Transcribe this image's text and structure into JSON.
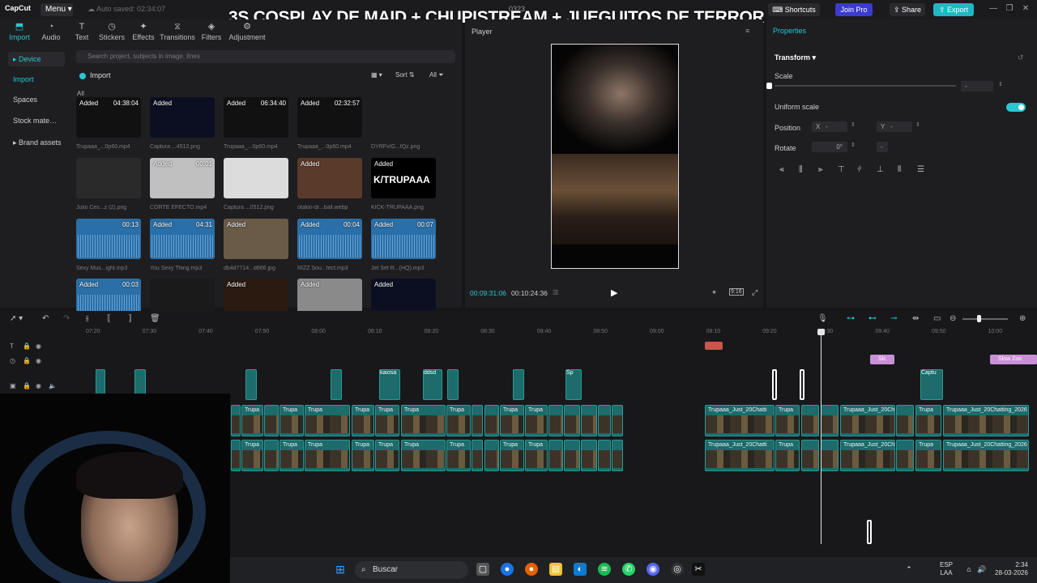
{
  "app": {
    "logo": "CapCut",
    "menu_label": "Menu",
    "autosave": "Auto saved: 02:34:07",
    "project_name": "0323"
  },
  "overlay_title": "3S COSPLAY DE MAID + CHUPISTREAM + JUEGUITOS DE TERROR",
  "topbar": {
    "shortcuts": "Shortcuts",
    "join_pro": "Join Pro",
    "share": "Share",
    "export": "Export"
  },
  "tool_tabs": [
    {
      "label": "Import",
      "icon": "import-icon"
    },
    {
      "label": "Audio",
      "icon": "audio-icon"
    },
    {
      "label": "Text",
      "icon": "text-icon"
    },
    {
      "label": "Stickers",
      "icon": "stickers-icon"
    },
    {
      "label": "Effects",
      "icon": "effects-icon"
    },
    {
      "label": "Transitions",
      "icon": "transitions-icon"
    },
    {
      "label": "Filters",
      "icon": "filters-icon"
    },
    {
      "label": "Adjustment",
      "icon": "adjustment-icon"
    }
  ],
  "side_nav": [
    "▸ Device",
    "Import",
    "Spaces",
    "Stock mate…",
    "▸ Brand assets"
  ],
  "media": {
    "search_placeholder": "Search project, subjects in image, lines",
    "import_label": "Import",
    "sort_label": "Sort",
    "filter_label": "All",
    "all_label": "All",
    "tiles": [
      {
        "added": "Added",
        "dur": "04:38:04",
        "caption": "Trupaaa_...0p60.mp4",
        "bg": "#111"
      },
      {
        "added": "Added",
        "dur": "",
        "caption": "Captura ...4512.png",
        "bg": "#0c0f22"
      },
      {
        "added": "Added",
        "dur": "06:34:40",
        "caption": "Trupaaa_...0p60.mp4",
        "bg": "#111"
      },
      {
        "added": "Added",
        "dur": "02:32:57",
        "caption": "Trupaaa_...0p60.mp4",
        "bg": "#111"
      },
      {
        "added": "",
        "dur": "",
        "caption": "DYRFvIG...fQz.png",
        "bg": "#1e1e21"
      },
      {
        "added": "",
        "dur": "",
        "caption": "Julio Ces...z (2).png",
        "bg": "#2a2a2a"
      },
      {
        "added": "Added",
        "dur": "00:01",
        "caption": "CORTE EFECTO.mp4",
        "bg": "#c0c0c0"
      },
      {
        "added": "",
        "dur": "",
        "caption": "Captura ...0512.png",
        "bg": "#dcdcdc"
      },
      {
        "added": "Added",
        "dur": "",
        "caption": "otakin-dr...ball.webp",
        "bg": "#5a3a2a"
      },
      {
        "added": "Added",
        "dur": "",
        "caption": "KICK-TRUPAAA.png",
        "bg": "#000"
      },
      {
        "added": "",
        "dur": "00:13",
        "caption": "Sexy Mus...ight.mp3",
        "bg": "#2a6fa8"
      },
      {
        "added": "Added",
        "dur": "04:31",
        "caption": "You Sexy Thing.mp3",
        "bg": "#2a6fa8"
      },
      {
        "added": "Added",
        "dur": "",
        "caption": "db4d7714...d866.jpg",
        "bg": "#6a5a48"
      },
      {
        "added": "Added",
        "dur": "00:04",
        "caption": "RIZZ Sou...fect.mp3",
        "bg": "#2a6fa8"
      },
      {
        "added": "Added",
        "dur": "00:07",
        "caption": "Jet Set R...(HQ).mp3",
        "bg": "#2a6fa8"
      },
      {
        "added": "Added",
        "dur": "00:03",
        "caption": "",
        "bg": "#2a6fa8"
      },
      {
        "added": "",
        "dur": "",
        "caption": "",
        "bg": "#1a1a1a"
      },
      {
        "added": "Added",
        "dur": "",
        "caption": "",
        "bg": "#2a1a10"
      },
      {
        "added": "Added",
        "dur": "",
        "caption": "",
        "bg": "#8a8a8a"
      },
      {
        "added": "Added",
        "dur": "",
        "caption": "",
        "bg": "#0c0f22"
      }
    ],
    "kick_logo": "K/TRUPAAA"
  },
  "player": {
    "title": "Player",
    "time_current": "00:09:31:06",
    "time_total": "00:10:24:36",
    "ratio": "9:16"
  },
  "properties": {
    "title": "Properties",
    "section": "Transform",
    "scale_label": "Scale",
    "scale_value": "-",
    "uniform_label": "Uniform scale",
    "position_label": "Position",
    "pos_x_label": "X",
    "pos_x_value": "-",
    "pos_y_label": "Y",
    "pos_y_value": "-",
    "rotate_label": "Rotate",
    "rotate_value": "0°",
    "rotate_flip": "-"
  },
  "timeline": {
    "ticks": [
      "07:20",
      "07:30",
      "07:40",
      "07:50",
      "08:00",
      "08:10",
      "08:20",
      "08:30",
      "08:40",
      "08:50",
      "09:00",
      "09:10",
      "09:20",
      "09:30",
      "09:40",
      "09:50",
      "10:00"
    ],
    "main_clip_label": "Trupa",
    "right_clip_label": "Trupaaa_Just_20Chatting_2026",
    "right_clip_label_short": "Trupaaa_Just_20Chatti",
    "small_labels": [
      "kaiosa",
      "ddsd",
      "Sp",
      "Captu"
    ],
    "pink_labels": [
      "Slc",
      "Slow Zoo"
    ]
  },
  "taskbar": {
    "search": "Buscar",
    "lang": "ESP",
    "lang2": "LAA",
    "time": "2:34",
    "date": "28-03-2026"
  }
}
